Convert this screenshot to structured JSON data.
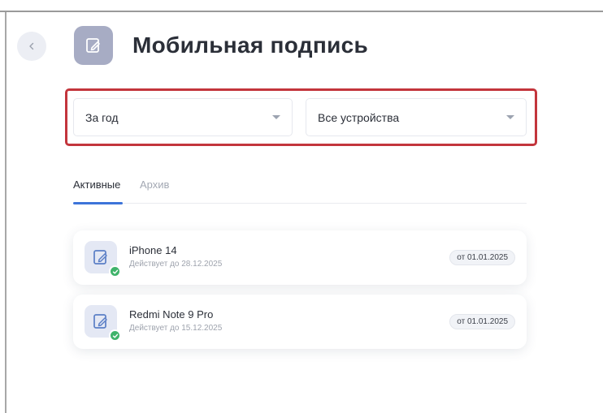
{
  "header": {
    "title": "Мобильная подпись",
    "back_icon": "chevron-left-icon",
    "title_icon": "signature-doc-icon"
  },
  "filters": {
    "period": {
      "selected": "За год"
    },
    "devices": {
      "selected": "Все устройства"
    }
  },
  "tabs": [
    {
      "label": "Активные",
      "active": true
    },
    {
      "label": "Архив",
      "active": false
    }
  ],
  "devices": [
    {
      "name": "iPhone 14",
      "valid_until": "Действует до 28.12.2025",
      "from_date": "от 01.01.2025",
      "status": "active"
    },
    {
      "name": "Redmi Note 9 Pro",
      "valid_until": "Действует до 15.12.2025",
      "from_date": "от 01.01.2025",
      "status": "active"
    }
  ],
  "colors": {
    "accent": "#3d74d9",
    "highlight_border": "#c3353c",
    "success": "#3fb36a",
    "title_icon_bg": "#a7acc4"
  }
}
